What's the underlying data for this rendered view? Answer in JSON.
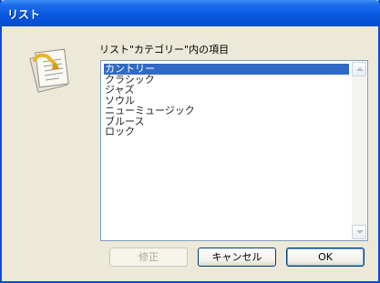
{
  "window": {
    "title": "リスト"
  },
  "dialog": {
    "icon": "document-edit-icon",
    "list_label": "リスト\"カテゴリー\"内の項目",
    "items": [
      "カントリー",
      "クラシック",
      "ジャズ",
      "ソウル",
      "ニューミュージック",
      "ブルース",
      "ロック"
    ],
    "selected_index": 0
  },
  "buttons": {
    "edit_label": "修正",
    "cancel_label": "キャンセル",
    "ok_label": "OK"
  },
  "colors": {
    "titlebar": "#0a58e0",
    "selection": "#316ac5",
    "dialog_bg": "#ece9d8"
  }
}
